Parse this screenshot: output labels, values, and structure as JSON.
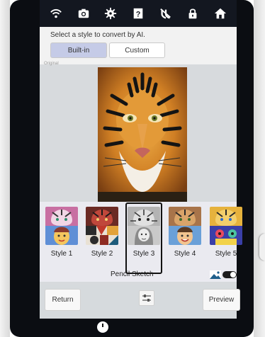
{
  "status_icons": [
    "wifi-icon",
    "camera-icon",
    "gear-icon",
    "help-icon",
    "mute-icon",
    "lock-icon",
    "home-icon"
  ],
  "header": {
    "prompt": "Select a style to convert by AI.",
    "tabs": [
      {
        "label": "Built-in",
        "selected": true
      },
      {
        "label": "Custom",
        "selected": false
      }
    ],
    "original_label": "Original"
  },
  "styles": {
    "items": [
      {
        "label": "Style 1"
      },
      {
        "label": "Style 2"
      },
      {
        "label": "Style 3",
        "selected": true
      },
      {
        "label": "Style 4"
      },
      {
        "label": "Style 5"
      }
    ],
    "selected_name": "Pencil Sketch"
  },
  "footer": {
    "return_label": "Return",
    "preview_label": "Preview"
  },
  "colors": {
    "tab_selected": "#c5cbe7",
    "status_bar": "#131720",
    "selection_border": "#111111"
  }
}
